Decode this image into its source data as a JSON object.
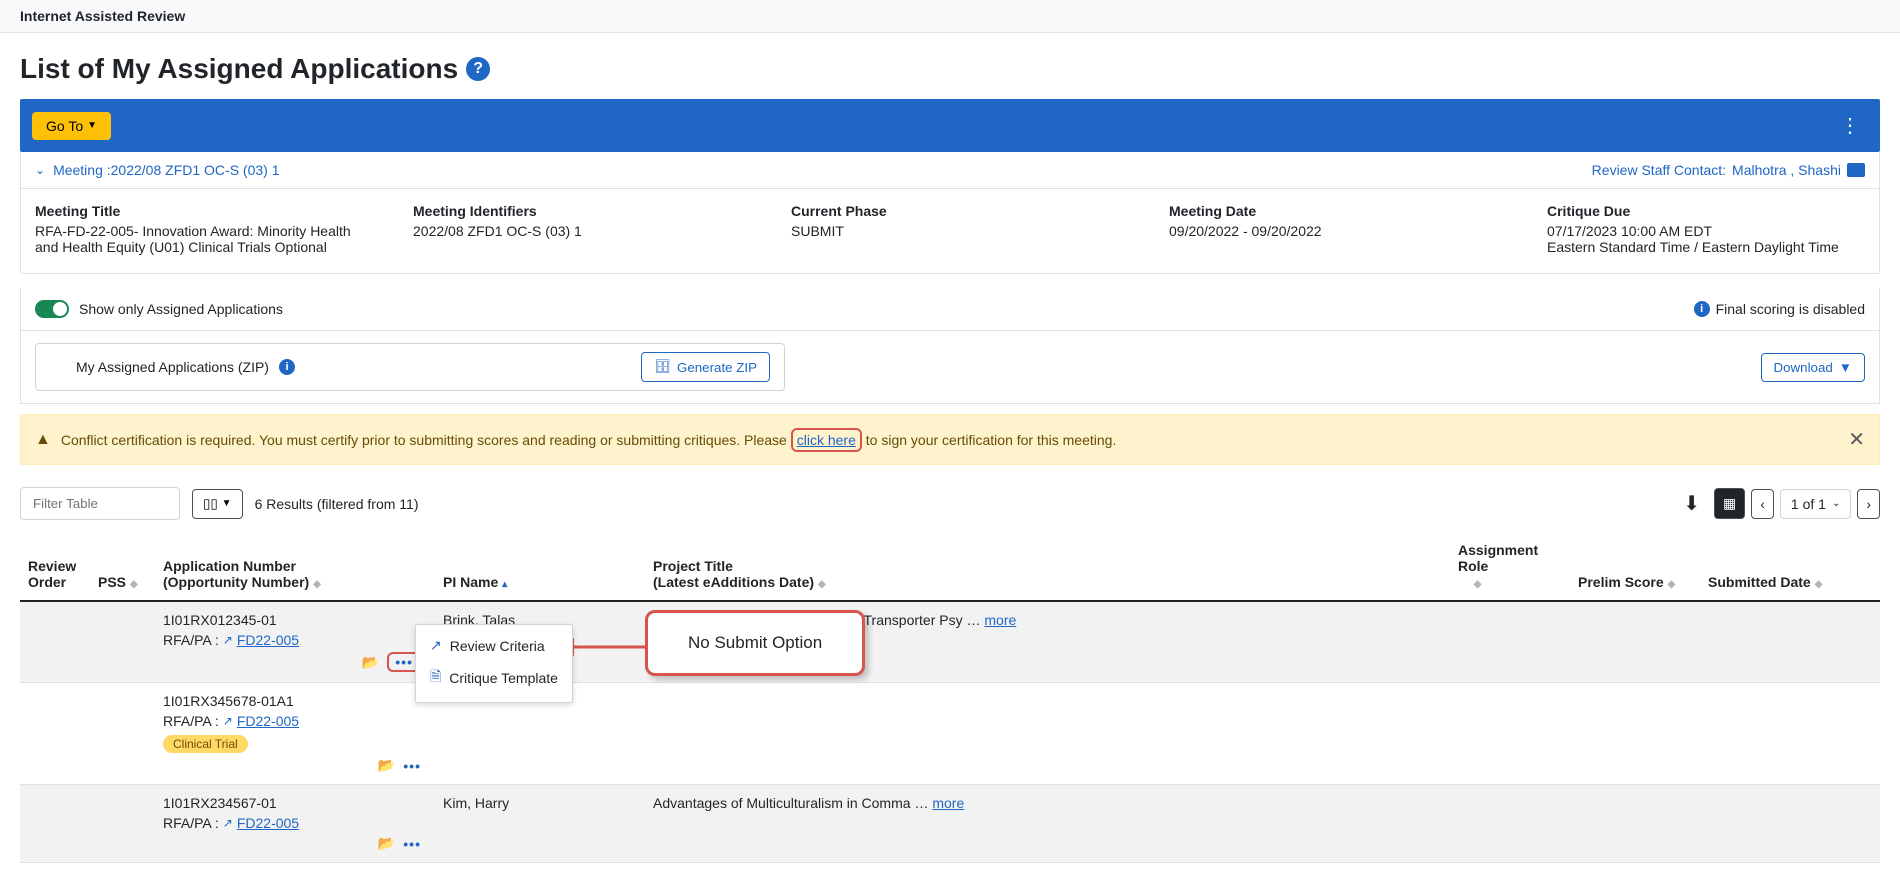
{
  "topBar": {
    "title": "Internet Assisted Review"
  },
  "pageTitle": "List of My Assigned Applications",
  "goTo": "Go To",
  "meeting": {
    "header": "Meeting :2022/08 ZFD1 OC-S (03) 1",
    "contactLabel": "Review Staff Contact: ",
    "contactName": "Malhotra , Shashi",
    "cols": [
      {
        "label": "Meeting Title",
        "value": "RFA-FD-22-005- Innovation Award: Minority Health and Health Equity (U01) Clinical Trials Optional"
      },
      {
        "label": "Meeting Identifiers",
        "value": "2022/08 ZFD1 OC-S (03) 1"
      },
      {
        "label": "Current Phase",
        "value": "SUBMIT"
      },
      {
        "label": "Meeting Date",
        "value": "09/20/2022 - 09/20/2022"
      },
      {
        "label": "Critique Due",
        "value": "07/17/2023 10:00 AM EDT",
        "value2": "Eastern Standard Time / Eastern Daylight Time"
      }
    ]
  },
  "toggle": {
    "label": "Show only Assigned Applications"
  },
  "scoring": "Final scoring is disabled",
  "zip": {
    "label": "My Assigned Applications (ZIP)",
    "generate": "Generate ZIP",
    "download": "Download"
  },
  "alert": {
    "pre": "Conflict certification is required. You must certify prior to submitting scores and reading or submitting critiques. Please ",
    "link": "click here",
    "post": " to sign your certification for this meeting."
  },
  "filter": {
    "placeholder": "Filter Table",
    "results": "6 Results (filtered from 11)",
    "page": "1 of 1"
  },
  "columns": {
    "reviewOrder": "Review Order",
    "pss": "PSS",
    "appNum1": "Application Number",
    "appNum2": "(Opportunity Number)",
    "piName": "PI Name",
    "project1": "Project Title",
    "project2": "(Latest eAdditions Date)",
    "role": "Assignment Role",
    "prelim": "Prelim Score",
    "submitted": "Submitted Date"
  },
  "rfaLabel": "RFA/PA : ",
  "popup": {
    "review": "Review Criteria",
    "template": "Critique Template"
  },
  "callout": "No Submit Option",
  "moreText": "more",
  "rows": [
    {
      "appNum": "1I01RX012345-01",
      "rfa": "FD22-005",
      "pi": "Brink, Talas",
      "title": "It's All in Your Head, Until It's Not: Transporter Psy",
      "ellipsis": "…",
      "showPopup": true,
      "clinicalTrial": false,
      "clinicalTrialLabel": ""
    },
    {
      "appNum": "1I01RX345678-01A1",
      "rfa": "FD22-005",
      "pi": "",
      "title": "",
      "ellipsis": "",
      "showPopup": false,
      "clinicalTrial": true,
      "clinicalTrialLabel": "Clinical Trial"
    },
    {
      "appNum": "1I01RX234567-01",
      "rfa": "FD22-005",
      "pi": "Kim, Harry",
      "title": "Advantages of Multiculturalism in Comma",
      "ellipsis": "…",
      "showPopup": false,
      "clinicalTrial": false,
      "clinicalTrialLabel": ""
    }
  ]
}
